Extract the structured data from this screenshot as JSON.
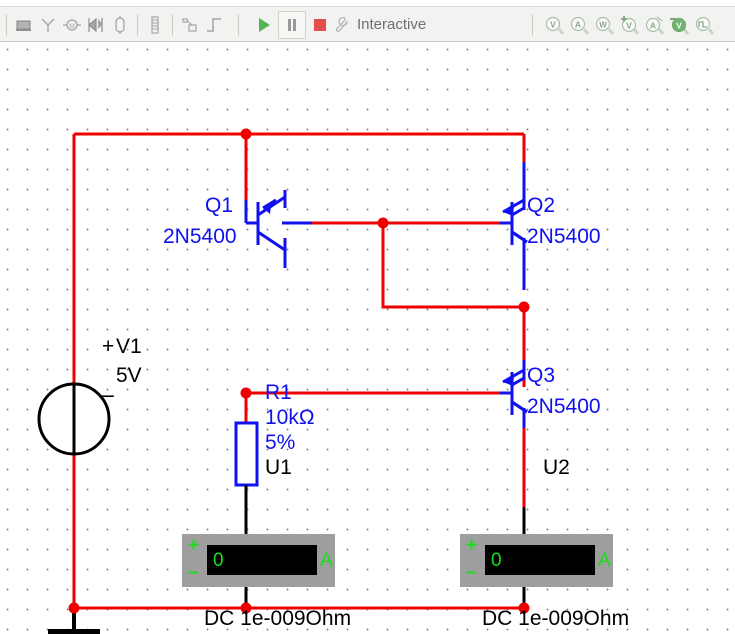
{
  "toolbar": {
    "left_icons": [
      {
        "name": "place-source-icon",
        "glyph": "source"
      },
      {
        "name": "place-ground-icon",
        "glyph": "ground"
      },
      {
        "name": "place-transistor-icon",
        "glyph": "transistor"
      },
      {
        "name": "place-diode-icon",
        "glyph": "diode"
      },
      {
        "name": "place-capacitor-icon",
        "glyph": "capacitor"
      }
    ],
    "second_icons": [
      {
        "name": "place-bus-icon",
        "glyph": "bus"
      },
      {
        "name": "place-subcircuit-icon",
        "glyph": "subcircuit"
      },
      {
        "name": "place-pulse-icon",
        "glyph": "pulse"
      }
    ],
    "run_button_label": "Run",
    "pause_button_label": "Pause",
    "stop_button_label": "Stop",
    "mode_label": "Interactive",
    "mode_icon": "wrench-icon",
    "probe_icons": [
      {
        "name": "voltage-probe-icon",
        "letter": "V"
      },
      {
        "name": "current-probe-icon",
        "letter": "A"
      },
      {
        "name": "power-probe-icon",
        "letter": "W"
      },
      {
        "name": "differential-voltage-probe-icon",
        "letter": "V"
      },
      {
        "name": "differential-current-probe-icon",
        "letter": "A"
      },
      {
        "name": "referenced-voltage-probe-icon",
        "letter": "V"
      },
      {
        "name": "waveform-probe-icon",
        "letter": "⊓"
      }
    ]
  },
  "schematic": {
    "source": {
      "designator": "V1",
      "value": "5V",
      "plus_sign": "+",
      "minus_sign": "–"
    },
    "resistor": {
      "designator": "R1",
      "value": "10kΩ",
      "tolerance": "5%"
    },
    "transistors": [
      {
        "designator": "Q1",
        "model": "2N5400",
        "type": "PNP"
      },
      {
        "designator": "Q2",
        "model": "2N5400",
        "type": "PNP"
      },
      {
        "designator": "Q3",
        "model": "2N5400",
        "type": "PNP"
      }
    ],
    "meters": [
      {
        "designator": "U1",
        "reading": "0",
        "unit": "A",
        "plus_sign": "+",
        "minus_sign": "–",
        "caption": "DC  1e-009Ohm"
      },
      {
        "designator": "U2",
        "reading": "0",
        "unit": "A",
        "plus_sign": "+",
        "minus_sign": "–",
        "caption": "DC  1e-009Ohm"
      }
    ],
    "ground": {
      "name": "ground-symbol"
    },
    "colors": {
      "wire": "#ee0000",
      "pin": "#1010f0",
      "label_blue": "#1010f0",
      "label_black": "#000000",
      "meter_body": "#9e9e9e",
      "meter_screen": "#000000",
      "meter_text": "#18e018",
      "selected": "#000000"
    }
  }
}
